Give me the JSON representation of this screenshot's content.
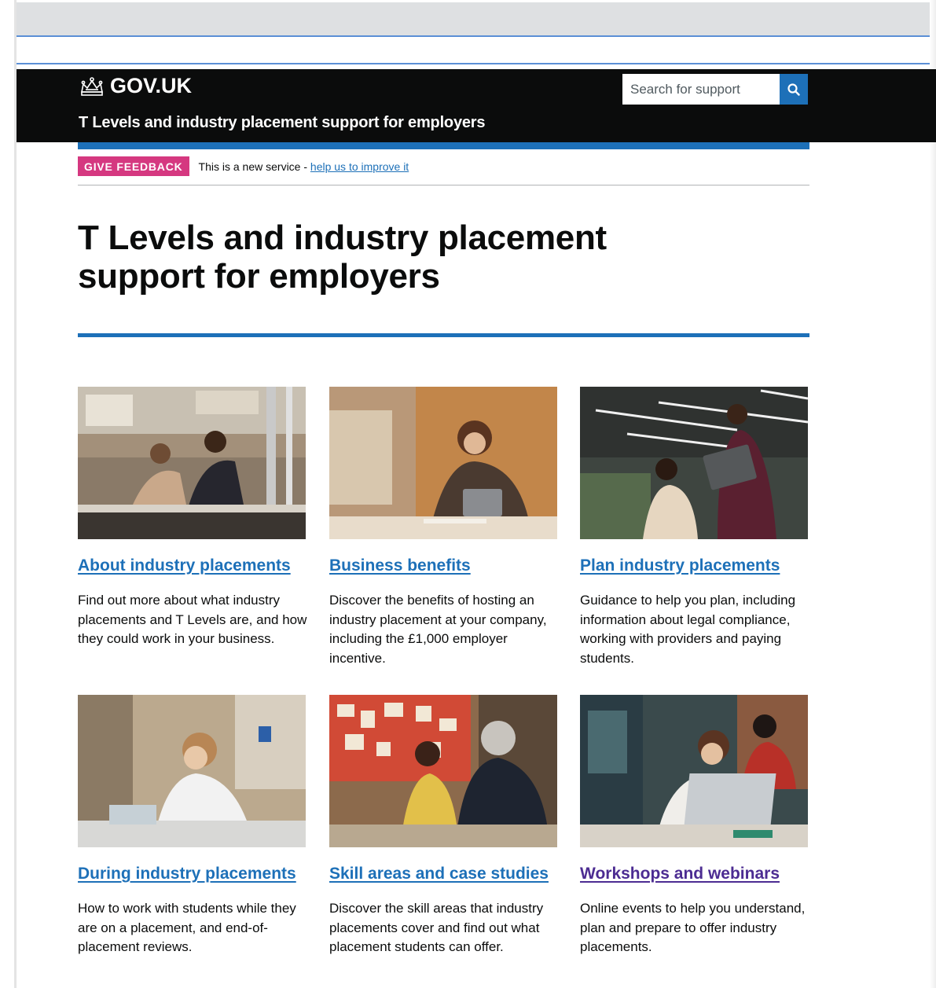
{
  "header": {
    "logo_text": "GOV.UK",
    "service_name": "T Levels and industry placement support for employers",
    "search_placeholder": "Search for support",
    "colors": {
      "background": "#0b0c0c",
      "accent": "#1d70b8"
    }
  },
  "phase_banner": {
    "tag": "GIVE FEEDBACK",
    "text_prefix": "This is a new service - ",
    "link_text": "help us to improve it",
    "tag_color": "#d53880"
  },
  "page_title_line1": "T Levels and industry placement",
  "page_title_line2": "support for employers",
  "cards": [
    {
      "title": "About industry placements",
      "description": "Find out more about what industry placements and T Levels are, and how they could work in your business.",
      "image_icon": "photo-students-working-icon"
    },
    {
      "title": "Business benefits",
      "description": "Discover the benefits of hosting an industry placement at your company, including the £1,000 employer incentive.",
      "image_icon": "photo-woman-with-tablet-icon"
    },
    {
      "title": "Plan industry placements",
      "description": "Guidance to help you plan, including information about legal compliance, working with providers and paying students.",
      "image_icon": "photo-office-laptop-icon"
    },
    {
      "title": "During industry placements",
      "description": "How to work with students while they are on a placement, and end-of-placement reviews.",
      "image_icon": "photo-lab-student-icon"
    },
    {
      "title": "Skill areas and case studies",
      "description": "Discover the skill areas that industry placements cover and find out what placement students can offer.",
      "image_icon": "photo-classroom-discussion-icon"
    },
    {
      "title": "Workshops and webinars",
      "description": "Online events to help you understand, plan and prepare to offer industry placements.",
      "image_icon": "photo-student-laptop-library-icon"
    }
  ]
}
